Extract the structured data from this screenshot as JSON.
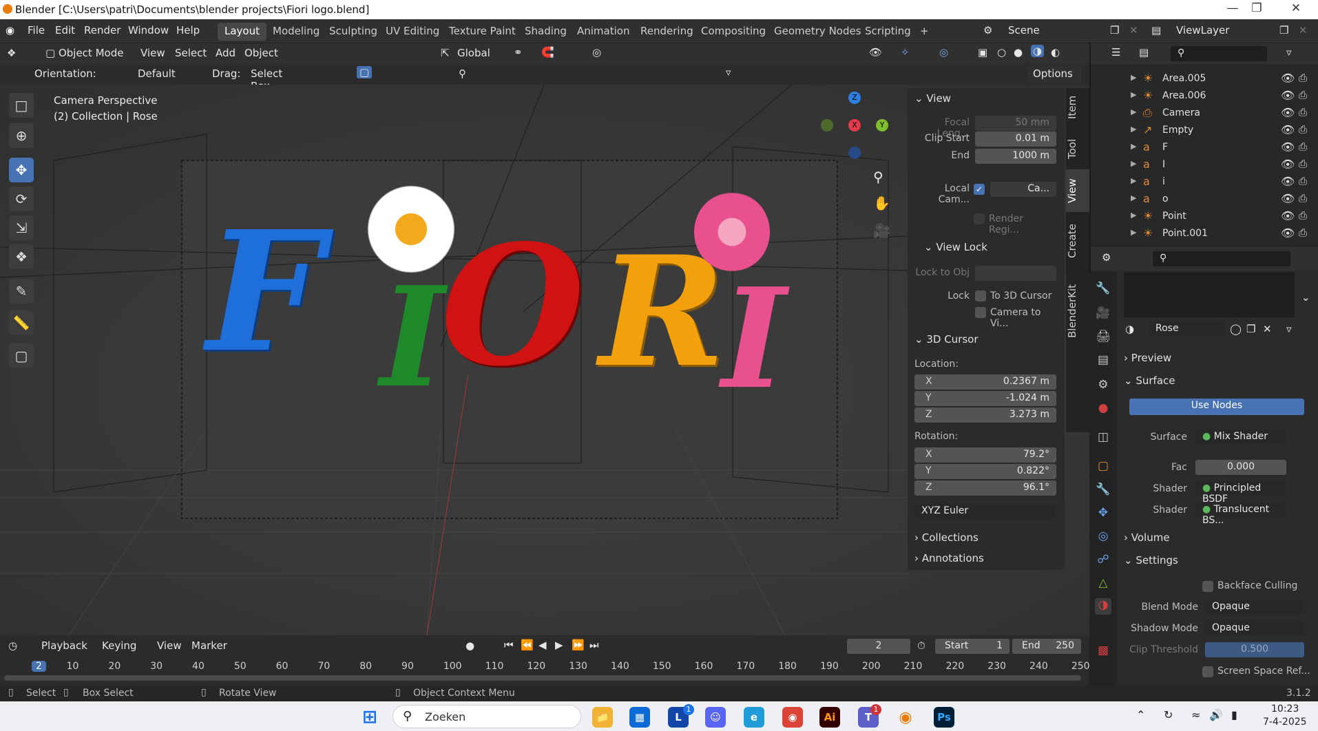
{
  "window": {
    "title": "Blender [C:\\Users\\patri\\Documents\\blender projects\\Fiori logo.blend]"
  },
  "menubar": {
    "items": [
      "File",
      "Edit",
      "Render",
      "Window",
      "Help"
    ]
  },
  "workspaces": {
    "tabs": [
      "Layout",
      "Modeling",
      "Sculpting",
      "UV Editing",
      "Texture Paint",
      "Shading",
      "Animation",
      "Rendering",
      "Compositing",
      "Geometry Nodes",
      "Scripting"
    ],
    "active": "Layout",
    "add": "+"
  },
  "scene": {
    "label": "Scene",
    "view_layer": "ViewLayer"
  },
  "viewport_header": {
    "mode": "Object Mode",
    "menus": [
      "View",
      "Select",
      "Add",
      "Object"
    ],
    "transform_orientation": "Global",
    "orientation_label": "Orientation:",
    "orientation_value": "Default",
    "drag_label": "Drag:",
    "drag_value": "Select Box",
    "options": "Options"
  },
  "viewport": {
    "camera_text": "Camera Perspective",
    "collection_text": "(2) Collection | Rose",
    "gizmo_axes": {
      "x": "X",
      "y": "Y",
      "z": "Z"
    },
    "logo_letters": [
      {
        "char": "F",
        "color": "#1e6fd9"
      },
      {
        "char": "I",
        "color": "#1f8a2a"
      },
      {
        "char": "O",
        "color": "#d11212"
      },
      {
        "char": "R",
        "color": "#f2a10c"
      },
      {
        "char": "I",
        "color": "#e8508e"
      }
    ]
  },
  "npanel": {
    "tabs": [
      "Item",
      "Tool",
      "View",
      "Create",
      "BlenderKit"
    ],
    "active_tab": "View",
    "view": {
      "title": "View",
      "focal_length_label": "Focal Leng...",
      "focal_length_value": "50 mm",
      "clip_start_label": "Clip Start",
      "clip_start_value": "0.01 m",
      "end_label": "End",
      "end_value": "1000 m",
      "local_camera_label": "Local Cam...",
      "local_camera_value": "Ca...",
      "render_region_label": "Render Regi..."
    },
    "view_lock": {
      "title": "View Lock",
      "lock_to_obj_label": "Lock to Obj",
      "lock_label": "Lock",
      "to_3d_cursor": "To 3D Cursor",
      "camera_to_view": "Camera to Vi..."
    },
    "cursor": {
      "title": "3D Cursor",
      "location_label": "Location:",
      "loc_x": "0.2367 m",
      "loc_y": "-1.024 m",
      "loc_z": "3.273 m",
      "rotation_label": "Rotation:",
      "rot_x": "79.2°",
      "rot_y": "0.822°",
      "rot_z": "96.1°",
      "rotation_mode": "XYZ Euler",
      "axis_x": "X",
      "axis_y": "Y",
      "axis_z": "Z"
    },
    "collections": "Collections",
    "annotations": "Annotations"
  },
  "outliner": {
    "items": [
      {
        "name": "Area.005",
        "icon": "light-icon"
      },
      {
        "name": "Area.006",
        "icon": "light-icon"
      },
      {
        "name": "Camera",
        "icon": "camera-icon"
      },
      {
        "name": "Empty",
        "icon": "empty-icon"
      },
      {
        "name": "F",
        "icon": "text-icon"
      },
      {
        "name": "I",
        "icon": "text-icon"
      },
      {
        "name": "i",
        "icon": "text-icon"
      },
      {
        "name": "o",
        "icon": "text-icon"
      },
      {
        "name": "Point",
        "icon": "light-icon"
      },
      {
        "name": "Point.001",
        "icon": "light-icon"
      }
    ]
  },
  "properties": {
    "material_name": "Rose",
    "preview": "Preview",
    "surface_section": "Surface",
    "use_nodes": "Use Nodes",
    "surface_label": "Surface",
    "surface_value": "Mix Shader",
    "fac_label": "Fac",
    "fac_value": "0.000",
    "shader_label": "Shader",
    "shader1_value": "Principled BSDF",
    "shader2_value": "Translucent BS...",
    "volume": "Volume",
    "settings": "Settings",
    "backface_culling": "Backface Culling",
    "blend_mode_label": "Blend Mode",
    "blend_mode_value": "Opaque",
    "shadow_mode_label": "Shadow Mode",
    "shadow_mode_value": "Opaque",
    "clip_threshold_label": "Clip Threshold",
    "clip_threshold_value": "0.500",
    "screen_space_ref": "Screen Space Ref..."
  },
  "timeline": {
    "menus": [
      "Playback",
      "Keying",
      "View",
      "Marker"
    ],
    "current_frame": "2",
    "start_label": "Start",
    "start_value": "1",
    "end_label": "End",
    "end_value": "250",
    "ruler": [
      "2",
      "10",
      "20",
      "30",
      "40",
      "50",
      "60",
      "70",
      "80",
      "90",
      "100",
      "110",
      "120",
      "130",
      "140",
      "150",
      "160",
      "170",
      "180",
      "190",
      "200",
      "210",
      "220",
      "230",
      "240",
      "250"
    ]
  },
  "statusbar": {
    "select": "Select",
    "box_select": "Box Select",
    "rotate_view": "Rotate View",
    "context_menu": "Object Context Menu",
    "version": "3.1.2"
  },
  "taskbar": {
    "search": "Zoeken",
    "time": "10:23",
    "date": "7-4-2025",
    "badges": {
      "l": "1",
      "teams": "1"
    }
  },
  "colors": {
    "accent": "#4772b3",
    "panel": "#2b2b2b",
    "viewport": "#393939"
  }
}
